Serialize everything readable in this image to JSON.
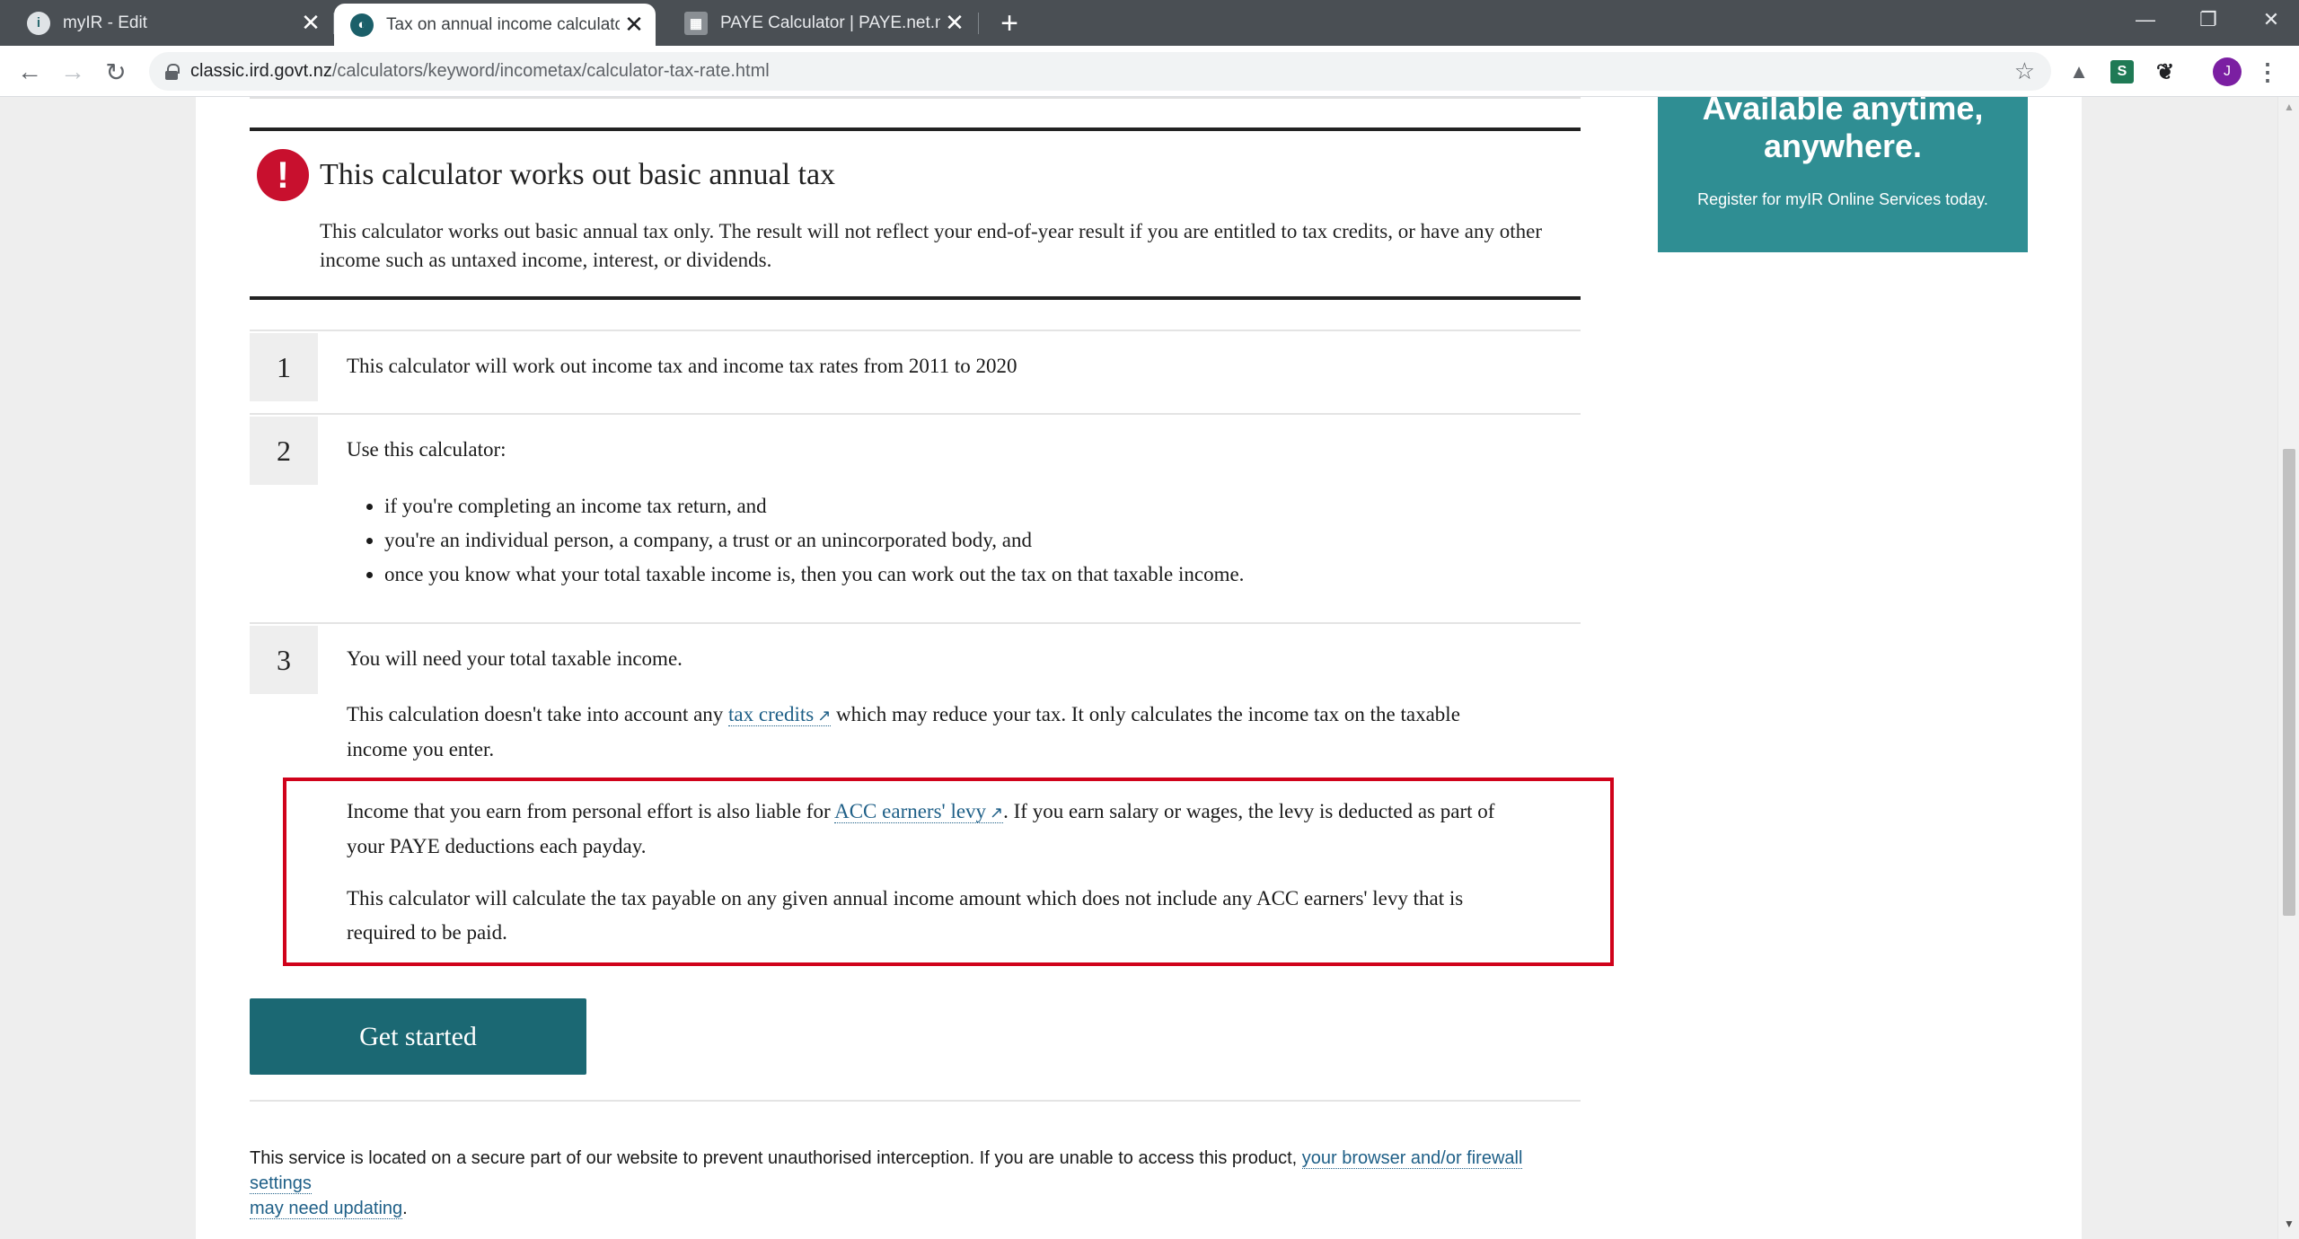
{
  "browser": {
    "tabs": [
      {
        "title": "myIR - Edit",
        "favicon": "ird-icon",
        "active": false
      },
      {
        "title": "Tax on annual income calculator",
        "favicon": "ird-globe-icon",
        "active": true
      },
      {
        "title": "PAYE Calculator | PAYE.net.nz",
        "favicon": "paye-icon",
        "active": false
      }
    ],
    "close_glyph": "✕",
    "new_tab_glyph": "+",
    "url_host": "classic.ird.govt.nz",
    "url_path": "/calculators/keyword/incometax/calculator-tax-rate.html",
    "avatar_initial": "J"
  },
  "promo": {
    "heading_line1": "Available anytime,",
    "heading_line2": "anywhere.",
    "subtext": "Register for myIR Online Services today."
  },
  "warning": {
    "icon_glyph": "!",
    "title": "This calculator works out basic annual tax",
    "body": "This calculator works out basic annual tax only. The result will not reflect your end-of-year result if you are entitled to tax credits, or have any other income such as untaxed income, interest, or dividends."
  },
  "steps": [
    {
      "number": "1",
      "text": "This calculator will work out income tax and income tax rates from 2011 to 2020"
    },
    {
      "number": "2",
      "text": "Use this calculator:",
      "bullets": [
        "if you're completing an income tax return, and",
        "you're an individual person, a company, a trust or an unincorporated body, and",
        "once you know what your total taxable income is, then you can work out the tax on that taxable income."
      ]
    },
    {
      "number": "3",
      "text": "You will need your total taxable income."
    }
  ],
  "step3_detail": {
    "p1_before": "This calculation doesn't take into account any ",
    "p1_link": "tax credits",
    "p1_after_line1": " which may reduce your tax. It only calculates the income tax on the taxable",
    "p1_after_line2": "income you enter.",
    "p2_before": "Income that you earn from personal effort is also liable for ",
    "p2_link": "ACC earners' levy",
    "p2_after_line1": ". If you earn salary or wages, the levy is deducted as part of",
    "p2_after_line2": "your PAYE deductions each payday.",
    "p3_line1": "This calculator will calculate the tax payable on any given annual income amount which does not include any ACC earners' levy that is",
    "p3_line2": "required to be paid.",
    "ext_arrow": "↗"
  },
  "get_started_label": "Get started",
  "footer": {
    "text_before": "This service is located on a secure part of our website to prevent unauthorised interception. If you are unable to access this product, ",
    "link_line1": "your browser and/or firewall settings",
    "link_line2": "may need updating",
    "text_after": "."
  }
}
